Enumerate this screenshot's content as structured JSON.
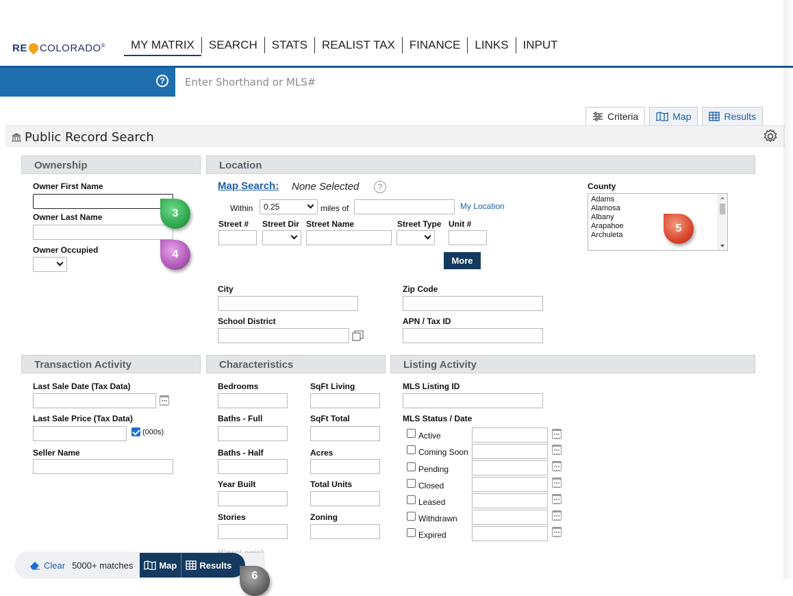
{
  "brand": {
    "re": "RE",
    "name": "COLORADO",
    "reg": "®"
  },
  "menu": [
    "MY MATRIX",
    "SEARCH",
    "STATS",
    "REALIST TAX",
    "FINANCE",
    "LINKS",
    "INPUT"
  ],
  "search": {
    "placeholder": "Enter Shorthand or MLS#",
    "help": "?"
  },
  "tabs": {
    "criteria": "Criteria",
    "map": "Map",
    "results": "Results"
  },
  "page_title": "Public Record Search",
  "sections": {
    "ownership": "Ownership",
    "location": "Location",
    "transaction": "Transaction Activity",
    "characteristics": "Characteristics",
    "listing": "Listing Activity"
  },
  "ownership": {
    "first_name": "Owner First Name",
    "last_name": "Owner Last Name",
    "occupied": "Owner Occupied"
  },
  "location": {
    "map_search": "Map Search:",
    "none_selected": "None Selected",
    "help": "?",
    "within": "Within",
    "radius": "0.25",
    "miles_of": "miles of",
    "my_location": "My Location",
    "street_no": "Street #",
    "street_dir": "Street Dir",
    "street_name": "Street Name",
    "street_type": "Street Type",
    "unit": "Unit #",
    "more": "More",
    "county": "County",
    "counties": [
      "Adams",
      "Alamosa",
      "Albany",
      "Arapahoe",
      "Archuleta"
    ],
    "city": "City",
    "zip": "Zip Code",
    "school": "School District",
    "apn": "APN / Tax ID"
  },
  "transaction": {
    "last_sale_date": "Last Sale Date (Tax Data)",
    "last_sale_price": "Last Sale Price (Tax Data)",
    "thousands": "(000s)",
    "seller": "Seller Name"
  },
  "characteristics": {
    "bedrooms": "Bedrooms",
    "sqft_living": "SqFt Living",
    "baths_full": "Baths - Full",
    "sqft_total": "SqFt Total",
    "baths_half": "Baths - Half",
    "acres": "Acres",
    "year_built": "Year Built",
    "total_units": "Total Units",
    "stories": "Stories",
    "zoning": "Zoning"
  },
  "listing": {
    "mls_id": "MLS Listing ID",
    "status_date": "MLS Status / Date",
    "statuses": [
      "Active",
      "Coming Soon",
      "Pending",
      "Closed",
      "Leased",
      "Withdrawn",
      "Expired"
    ]
  },
  "badges": {
    "b3": "3",
    "b4": "4",
    "b5": "5",
    "b6": "6"
  },
  "bottom": {
    "clear": "Clear",
    "matches": "5000+ matches",
    "map": "Map",
    "results": "Results",
    "faded": "(CoreLogic)"
  },
  "colors": {
    "brand_blue": "#1f6fb0",
    "nav_dark": "#143a5f",
    "badge_green": "#2fa84f",
    "badge_pink": "#b05ab8",
    "badge_red": "#d9462b"
  }
}
